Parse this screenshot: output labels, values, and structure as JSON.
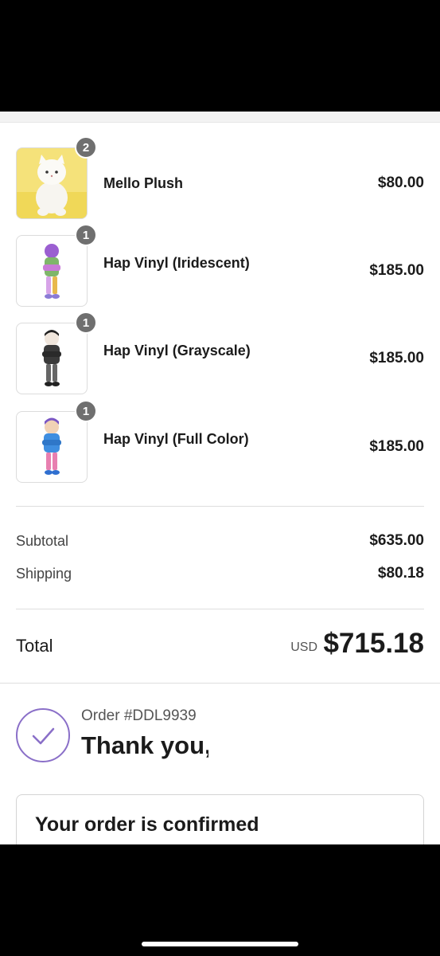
{
  "items": [
    {
      "name": "Mello Plush",
      "qty": "2",
      "price": "$80.00",
      "icon": "white-cat-plush-image"
    },
    {
      "name": "Hap Vinyl (Iridescent)",
      "qty": "1",
      "price": "$185.00",
      "icon": "iridescent-vinyl-figure-image"
    },
    {
      "name": "Hap Vinyl (Grayscale)",
      "qty": "1",
      "price": "$185.00",
      "icon": "grayscale-vinyl-figure-image"
    },
    {
      "name": "Hap Vinyl (Full Color)",
      "qty": "1",
      "price": "$185.00",
      "icon": "full-color-vinyl-figure-image"
    }
  ],
  "summary": {
    "subtotal_label": "Subtotal",
    "subtotal_value": "$635.00",
    "shipping_label": "Shipping",
    "shipping_value": "$80.18",
    "total_label": "Total",
    "currency": "USD",
    "total_value": "$715.18"
  },
  "confirmation": {
    "order_number": "Order #DDL9939",
    "thanks": "Thank you,",
    "card_title": "Your order is confirmed",
    "check_icon": "checkmark-circle-icon"
  },
  "colors": {
    "accent": "#8a6fc8",
    "badge": "#6f6f6f"
  }
}
